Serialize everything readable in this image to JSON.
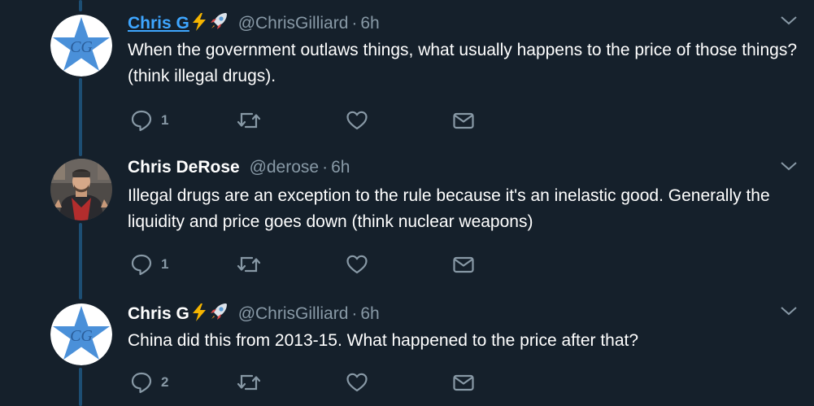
{
  "tweets": [
    {
      "name": "Chris G",
      "emojis": [
        "lightning-emoji",
        "rocket-emoji"
      ],
      "handle": "@ChrisGilliard",
      "dot": "·",
      "time": "6h",
      "text": "When the government outlaws things, what usually happens to the price of those things? (think illegal drugs).",
      "reply_count": "1",
      "avatar": "cg-star-logo",
      "avatar_text": "CG"
    },
    {
      "name": "Chris DeRose",
      "emojis": [],
      "handle": "@derose",
      "dot": "·",
      "time": "6h",
      "text": "Illegal drugs are an exception to the rule because it's an inelastic good. Generally the liquidity and price goes down (think nuclear weapons)",
      "reply_count": "1",
      "avatar": "person-photo"
    },
    {
      "name": "Chris G",
      "emojis": [
        "lightning-emoji",
        "rocket-emoji"
      ],
      "handle": "@ChrisGilliard",
      "dot": "·",
      "time": "6h",
      "text": "China did this from 2013-15. What happened to the price after that?",
      "reply_count": "2",
      "avatar": "cg-star-logo",
      "avatar_text": "CG"
    }
  ],
  "colors": {
    "background": "#15202b",
    "muted": "#8899a6",
    "link": "#3ea6ff",
    "thread_line": "#1d4e73",
    "star": "#4a90d9"
  }
}
